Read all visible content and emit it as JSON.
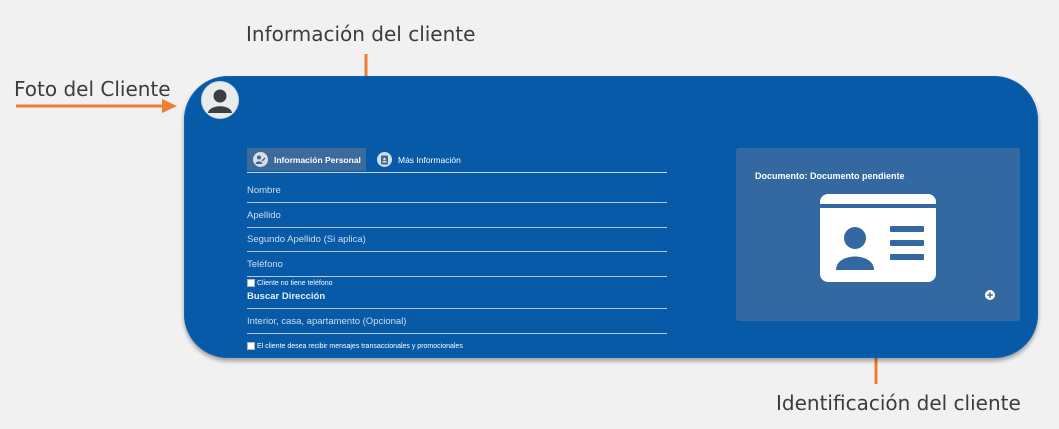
{
  "callouts": {
    "client_info": "Información del cliente",
    "client_photo": "Foto del Cliente",
    "client_id": "Identificación del cliente"
  },
  "tabs": [
    {
      "label": "Información Personal",
      "active": true,
      "icon": "user-edit-icon"
    },
    {
      "label": "Más Información",
      "active": false,
      "icon": "contact-card-icon"
    }
  ],
  "form": {
    "nombre": "Nombre",
    "apellido": "Apellido",
    "segundo_apellido": "Segundo Apellido (Si aplica)",
    "telefono": "Teléfono",
    "no_phone_checkbox": "Cliente no tiene teléfono",
    "buscar_direccion": "Buscar Dirección",
    "interior": "Interior, casa, apartamento (Opcional)",
    "marketing_checkbox": "El cliente desea recibir mensajes transaccionales y promocionales"
  },
  "document": {
    "title": "Documento: Documento pendiente",
    "icon": "id-card-icon",
    "add_icon": "plus-circle-icon"
  },
  "colors": {
    "card_bg": "#075aa8",
    "panel_bg": "#3468a0",
    "arrow": "#ef7d32",
    "page_bg": "#f1f1f1"
  }
}
